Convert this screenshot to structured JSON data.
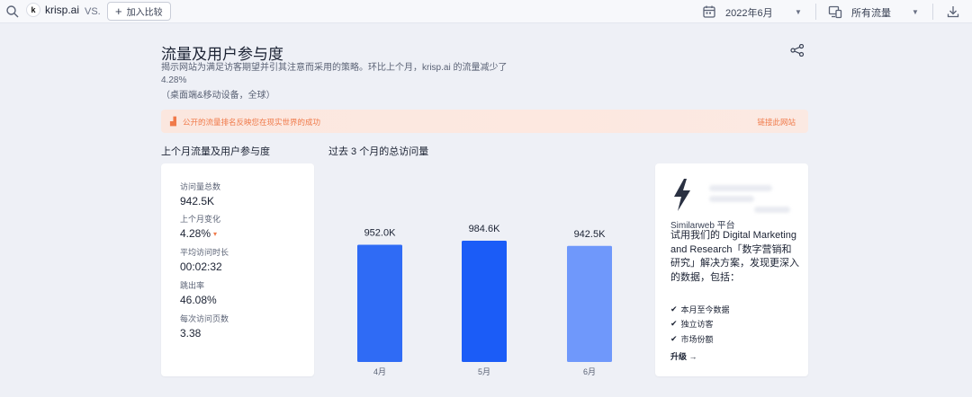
{
  "topbar": {
    "site_logo": "k",
    "site_name": "krisp.ai",
    "vs": "VS.",
    "add_compare": "加入比较",
    "date": "2022年6月",
    "traffic": "所有流量"
  },
  "header": {
    "title": "流量及用户参与度",
    "description": "揭示网站为满足访客期望并引其注意而采用的策略。环比上个月，krisp.ai 的流量减少了 4.28%",
    "scope": "（桌面端&移动设备，全球）"
  },
  "banner": {
    "text": "公开的流量排名反映您在现实世界的成功",
    "link": "链接此网站"
  },
  "metrics": {
    "section_title": "上个月流量及用户参与度",
    "items": [
      {
        "label": "访问量总数",
        "value": "942.5K"
      },
      {
        "label": "上个月变化",
        "value": "4.28%"
      },
      {
        "label": "平均访问时长",
        "value": "00:02:32"
      },
      {
        "label": "跳出率",
        "value": "46.08%"
      },
      {
        "label": "每次访问页数",
        "value": "3.38"
      }
    ]
  },
  "chart_section_title": "过去 3 个月的总访问量",
  "chart_data": {
    "type": "bar",
    "categories": [
      "4月",
      "5月",
      "6月"
    ],
    "values": [
      952.0,
      984.6,
      942.5
    ],
    "labels": [
      "952.0K",
      "984.6K",
      "942.5K"
    ],
    "ylim": [
      0,
      1100
    ],
    "colors": [
      "#2f6bf5",
      "#1b5cf7",
      "#6f98fb"
    ],
    "grid": false
  },
  "promo": {
    "brand": "Similarweb 平台",
    "headline": "试用我们的 Digital Marketing and Research「数字营销和研究」解决方案，发现更深入的数据，包括：",
    "features": [
      "本月至今数据",
      "独立访客",
      "市场份额"
    ],
    "upgrade": "升级 →"
  },
  "colors": {
    "accent": "#1b5cf7",
    "warning": "#f07a4a"
  }
}
